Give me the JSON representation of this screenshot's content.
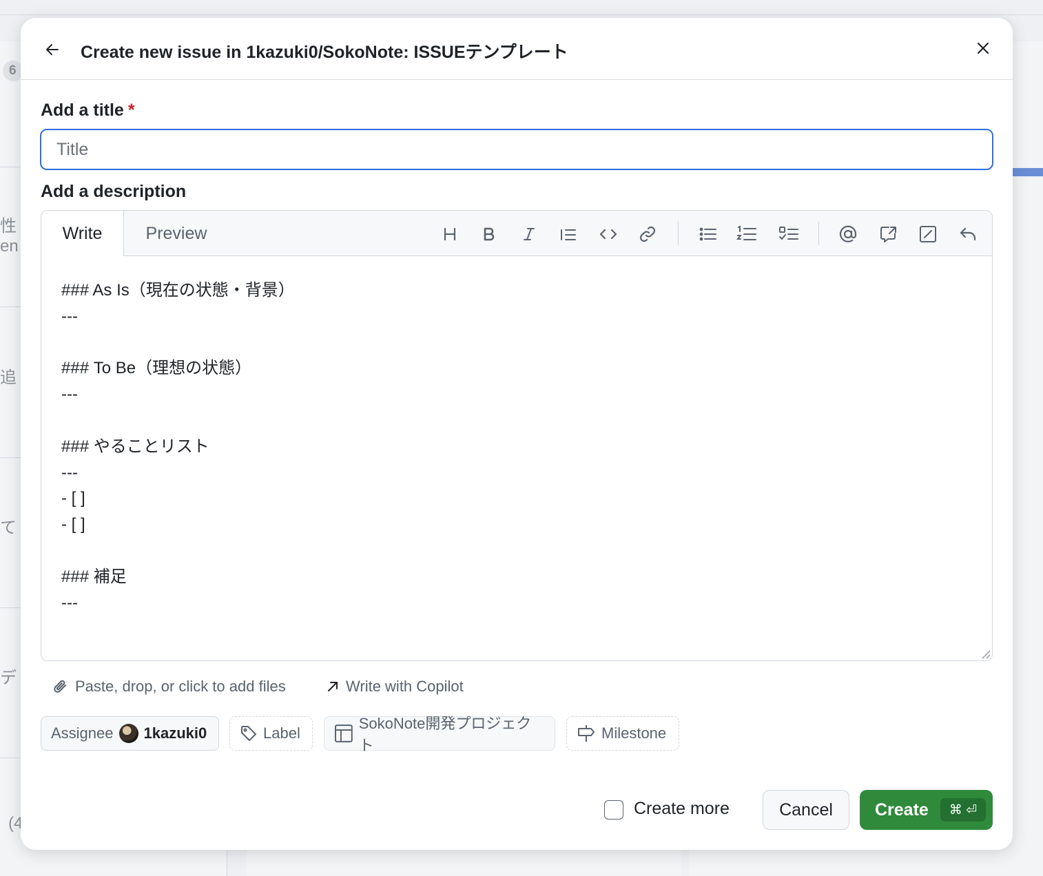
{
  "dialog": {
    "title": "Create new issue in 1kazuki0/SokoNote: ISSUEテンプレート"
  },
  "form": {
    "title_label": "Add a title",
    "required_mark": "*",
    "title_placeholder": "Title",
    "title_value": "",
    "description_label": "Add a description"
  },
  "editor": {
    "tabs": [
      {
        "label": "Write",
        "active": true
      },
      {
        "label": "Preview",
        "active": false
      }
    ],
    "toolbar": [
      "heading-icon",
      "bold-icon",
      "italic-icon",
      "quote-icon",
      "code-icon",
      "link-icon",
      "unordered-list-icon",
      "ordered-list-icon",
      "task-list-icon",
      "mention-icon",
      "reference-icon",
      "saved-replies-icon",
      "undo-icon"
    ],
    "body": "### As Is（現在の状態・背景）\n---\n\n### To Be（理想の状態）\n---\n\n### やることリスト\n---\n- [ ]\n- [ ]\n\n### 補足\n---"
  },
  "attachments": {
    "files_text": "Paste, drop, or click to add files",
    "copilot_text": "Write with Copilot"
  },
  "metadata": {
    "assignee_label": "Assignee",
    "assignee_name": "1kazuki0",
    "label_label": "Label",
    "project_label": "SokoNote開発プロジェクト",
    "milestone_label": "Milestone"
  },
  "actions": {
    "create_more_label": "Create more",
    "create_more_checked": false,
    "cancel_label": "Cancel",
    "create_label": "Create",
    "create_shortcut": "⌘ ⏎"
  },
  "background": {
    "badge": "6",
    "fragments": [
      "性",
      "en",
      "追",
      "て",
      "デ",
      "(4"
    ]
  },
  "colors": {
    "primary_button": "#2f8a3c",
    "focus_border": "#2f6fde",
    "required": "#cf222e"
  }
}
